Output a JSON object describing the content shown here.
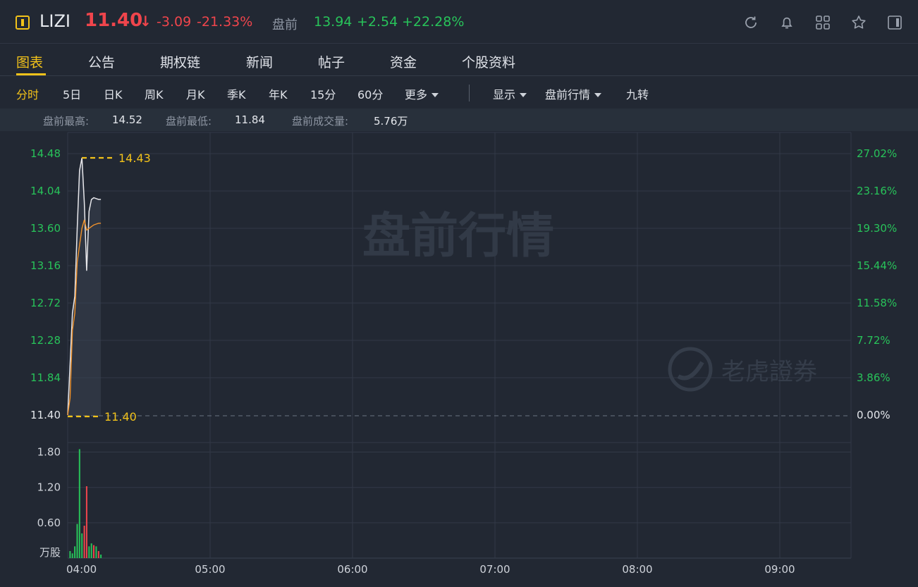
{
  "header": {
    "ticker": "LIZI",
    "price": "11.40",
    "price_arrow": "↓",
    "change": "-3.09",
    "change_pct": "-21.33%",
    "premarket_label": "盘前",
    "premarket_price": "13.94",
    "premarket_change": "+2.54",
    "premarket_change_pct": "+22.28%",
    "icons": [
      "refresh-icon",
      "bell-icon",
      "grid-icon",
      "star-icon",
      "panel-icon"
    ]
  },
  "tabs": [
    {
      "label": "图表",
      "active": true
    },
    {
      "label": "公告",
      "active": false
    },
    {
      "label": "期权链",
      "active": false
    },
    {
      "label": "新闻",
      "active": false
    },
    {
      "label": "帖子",
      "active": false
    },
    {
      "label": "资金",
      "active": false
    },
    {
      "label": "个股资料",
      "active": false
    }
  ],
  "periods": {
    "items": [
      "分时",
      "5日",
      "日K",
      "周K",
      "月K",
      "季K",
      "年K",
      "15分",
      "60分"
    ],
    "more": "更多",
    "display": "显示",
    "market": "盘前行情",
    "nine": "九转"
  },
  "stats": {
    "high_label": "盘前最高:",
    "high": "14.52",
    "low_label": "盘前最低:",
    "low": "11.84",
    "volume_label": "盘前成交量:",
    "volume": "5.76万"
  },
  "colors": {
    "up": "#28c35a",
    "down": "#f0454c",
    "accent": "#f2c21a",
    "bg": "#222833",
    "price_line": "#e8e8ec",
    "avg_line": "#f0922b"
  },
  "chart_data": {
    "type": "line",
    "watermark": "盘前行情",
    "brand_watermark": "老虎證券",
    "x_ticks": [
      "04:00",
      "05:00",
      "06:00",
      "07:00",
      "08:00",
      "09:00"
    ],
    "y_ticks": [
      "14.48",
      "14.04",
      "13.60",
      "13.16",
      "12.72",
      "12.28",
      "11.84",
      "11.40"
    ],
    "y_ticks_pct": [
      "27.02%",
      "23.16%",
      "19.30%",
      "15.44%",
      "11.58%",
      "7.72%",
      "3.86%",
      "0.00%"
    ],
    "ylim": [
      11.4,
      14.48
    ],
    "x_range_minutes": [
      0,
      330
    ],
    "max_marker": "14.43",
    "min_marker": "11.40",
    "series": [
      {
        "x": [
          0,
          1,
          2,
          3,
          4,
          5,
          6,
          7,
          8,
          9,
          10,
          11,
          12,
          13,
          14
        ],
        "values": [
          11.4,
          12.0,
          12.6,
          12.8,
          13.6,
          14.28,
          14.43,
          13.9,
          13.1,
          13.8,
          13.94,
          13.96,
          13.95,
          13.94,
          13.94
        ]
      },
      {
        "x": [
          0,
          1,
          2,
          3,
          4,
          5,
          6,
          7,
          8,
          9,
          10,
          11,
          12,
          13,
          14
        ],
        "values": [
          11.4,
          11.6,
          12.4,
          12.6,
          13.2,
          13.4,
          13.6,
          13.7,
          13.58,
          13.6,
          13.62,
          13.64,
          13.65,
          13.66,
          13.66
        ]
      }
    ],
    "volume": {
      "y_ticks": [
        "1.80",
        "1.20",
        "0.60"
      ],
      "unit": "万股",
      "ylim": [
        0,
        1.95
      ],
      "x": [
        1,
        2,
        3,
        4,
        5,
        6,
        7,
        8,
        9,
        10,
        11,
        12,
        13,
        14
      ],
      "values": [
        0.12,
        0.08,
        0.2,
        0.58,
        1.85,
        0.42,
        0.55,
        1.22,
        0.2,
        0.25,
        0.22,
        0.2,
        0.12,
        0.06
      ],
      "up": [
        true,
        true,
        true,
        true,
        true,
        true,
        false,
        false,
        true,
        true,
        false,
        true,
        false,
        true
      ]
    }
  }
}
